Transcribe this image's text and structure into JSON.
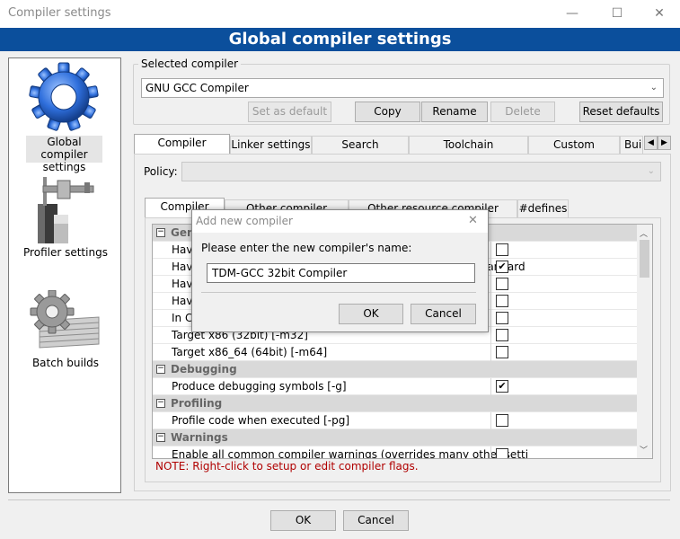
{
  "window": {
    "title": "Compiler settings",
    "banner": "Global compiler settings",
    "minimize": "—",
    "maximize": "☐",
    "close": "✕"
  },
  "nav": [
    {
      "label": "Global compiler settings",
      "icon": "gear-icon"
    },
    {
      "label": "Profiler settings",
      "icon": "caliper-icon"
    },
    {
      "label": "Batch builds",
      "icon": "batch-gear-icon"
    }
  ],
  "selected_compiler": {
    "legend": "Selected compiler",
    "value": "GNU GCC Compiler",
    "buttons": {
      "set_default": "Set as default",
      "copy": "Copy",
      "rename": "Rename",
      "delete": "Delete",
      "reset": "Reset defaults"
    }
  },
  "tabs": [
    "Compiler settings",
    "Linker settings",
    "Search directories",
    "Toolchain executables",
    "Custom variables",
    "Bui"
  ],
  "policy": {
    "label": "Policy:",
    "value": ""
  },
  "subtabs": [
    "Compiler Flags",
    "Other compiler options",
    "Other resource compiler options",
    "#defines"
  ],
  "flags": [
    {
      "type": "cat",
      "label": "General",
      "expander": "−"
    },
    {
      "type": "opt",
      "label": "Have g++ follow the 1998 ISO C++ language standard",
      "checked": false
    },
    {
      "type": "opt",
      "label": "Have g++ follow the coming C++0x ISO C++ language standard",
      "checked": true
    },
    {
      "type": "opt",
      "label": "Have g++ follow the C++11 ISO C++ language standard",
      "checked": false
    },
    {
      "type": "opt",
      "label": "Have gcc follow the 1990 ISO C language standard",
      "checked": false
    },
    {
      "type": "opt",
      "label": "In C mode, this is equivalent to -std=c90",
      "checked": false
    },
    {
      "type": "opt",
      "label": "Target x86 (32bit)  [-m32]",
      "checked": false
    },
    {
      "type": "opt",
      "label": "Target x86_64 (64bit)  [-m64]",
      "checked": false
    },
    {
      "type": "cat",
      "label": "Debugging",
      "expander": "−"
    },
    {
      "type": "opt",
      "label": "Produce debugging symbols  [-g]",
      "checked": true
    },
    {
      "type": "cat",
      "label": "Profiling",
      "expander": "−"
    },
    {
      "type": "opt",
      "label": "Profile code when executed  [-pg]",
      "checked": false
    },
    {
      "type": "cat",
      "label": "Warnings",
      "expander": "−"
    },
    {
      "type": "opt",
      "label": "Enable all common compiler warnings (overrides many other setti",
      "checked": false
    }
  ],
  "note": "NOTE: Right-click to setup or edit compiler flags.",
  "footer": {
    "ok": "OK",
    "cancel": "Cancel"
  },
  "dialog": {
    "title": "Add new compiler",
    "close": "✕",
    "prompt": "Please enter the new compiler's name:",
    "value": "TDM-GCC 32bit Compiler",
    "ok": "OK",
    "cancel": "Cancel"
  },
  "colors": {
    "banner": "#0b4f9c",
    "note": "#b00000"
  }
}
